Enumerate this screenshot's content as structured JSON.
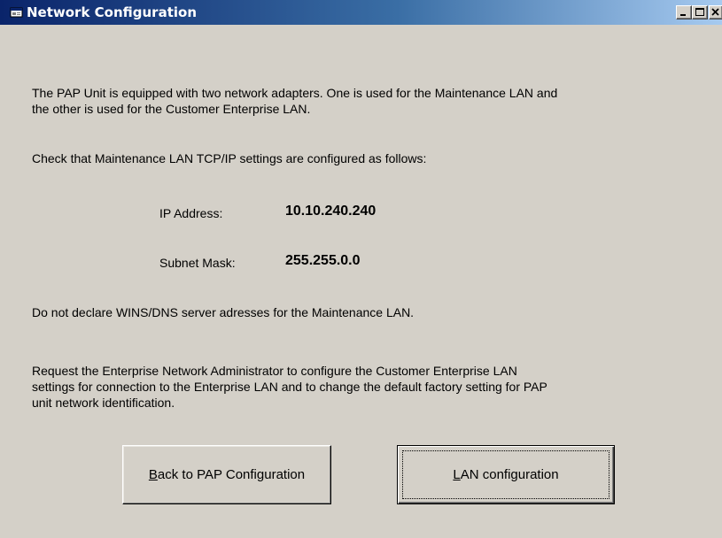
{
  "window": {
    "title": "Network Configuration",
    "controls": [
      "minimize",
      "maximize",
      "close"
    ]
  },
  "intro": {
    "line1": "The PAP Unit is equipped with two network adapters. One is used for the Maintenance LAN and",
    "line2": "the other is used for the Customer Enterprise LAN."
  },
  "check_text": "Check that Maintenance LAN TCP/IP settings are configured as follows:",
  "settings": {
    "ip_label": "IP Address:",
    "ip_value": "10.10.240.240",
    "mask_label": "Subnet Mask:",
    "mask_value": "255.255.0.0"
  },
  "wins_text": "Do not declare WINS/DNS server adresses for the Maintenance LAN.",
  "request": {
    "line1": "Request the Enterprise Network Administrator to configure the Customer Enterprise LAN",
    "line2": "settings for connection to the Enterprise LAN and to change the default factory setting for PAP",
    "line3": "unit network identification."
  },
  "buttons": {
    "back": {
      "accel": "B",
      "rest": "ack to PAP Configuration"
    },
    "lan": {
      "accel": "L",
      "rest": "AN configuration"
    }
  },
  "icons": {
    "title": "window-app-icon",
    "minimize": "minimize-icon",
    "maximize": "maximize-icon",
    "close": "close-icon"
  }
}
